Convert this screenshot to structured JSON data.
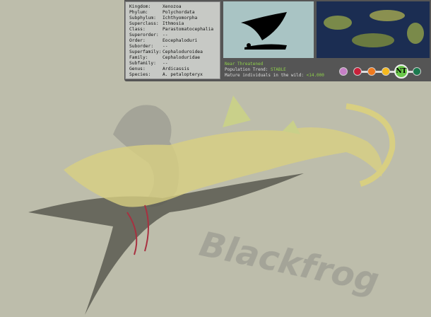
{
  "taxonomy": [
    {
      "rank": "Kingdom:",
      "value": "Xenozoa"
    },
    {
      "rank": "Phylum:",
      "value": "Polychordata"
    },
    {
      "rank": "Subphylum:",
      "value": "Ichthyomorpha"
    },
    {
      "rank": "Superclass:",
      "value": "Ithmosia"
    },
    {
      "rank": "Class:",
      "value": "Parastomatocephalia"
    },
    {
      "rank": "Superorder:",
      "value": "--"
    },
    {
      "rank": "Order:",
      "value": "Eocephaloduri"
    },
    {
      "rank": "Suborder:",
      "value": "--"
    },
    {
      "rank": "Superfamily:",
      "value": "Cephaloduroidea"
    },
    {
      "rank": "Family:",
      "value": "Cephaloduridae"
    },
    {
      "rank": "Subfamily:",
      "value": "--"
    },
    {
      "rank": "Genus:",
      "value": "Ardicassis"
    },
    {
      "rank": "Species:",
      "value": "A. petalopteryx"
    }
  ],
  "status": {
    "category": "Near Threatened",
    "trend_label": "Population Trend:",
    "trend": "STABLE",
    "mature_label": "Mature individuals in the wild:",
    "mature": "<14.000",
    "current_badge": "NT",
    "scale_colors": [
      "#c77fc7",
      "#c8203a",
      "#f07a1e",
      "#f5b91e",
      "#6ac84a",
      "#1a7a4e"
    ]
  },
  "watermark": "Blackfrog"
}
